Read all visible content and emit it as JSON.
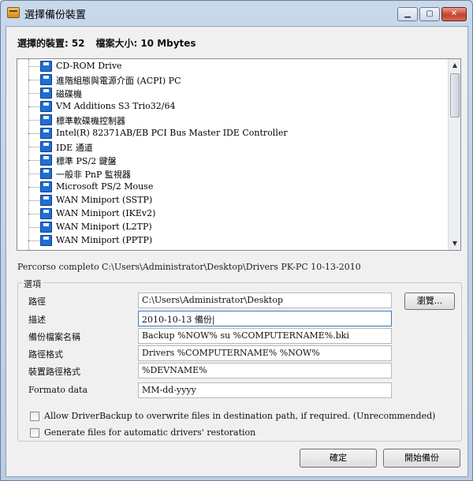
{
  "window": {
    "title": "選擇備份裝置"
  },
  "summary": {
    "devices_label": "選擇的裝置:",
    "devices_count": "52",
    "size_label": "檔案大小:",
    "size_value": "10 Mbytes"
  },
  "tree": {
    "items": [
      {
        "label": "CD-ROM Drive"
      },
      {
        "label": "進階組態與電源介面 (ACPI) PC"
      },
      {
        "label": "磁碟機"
      },
      {
        "label": "VM Additions S3 Trio32/64"
      },
      {
        "label": "標準軟碟機控制器"
      },
      {
        "label": "Intel(R) 82371AB/EB PCI Bus Master IDE Controller"
      },
      {
        "label": "IDE 通道"
      },
      {
        "label": "標準 PS/2 鍵盤"
      },
      {
        "label": "一般非 PnP 監視器"
      },
      {
        "label": "Microsoft PS/2 Mouse"
      },
      {
        "label": "WAN Miniport (SSTP)"
      },
      {
        "label": "WAN Miniport (IKEv2)"
      },
      {
        "label": "WAN Miniport (L2TP)"
      },
      {
        "label": "WAN Miniport (PPTP)"
      }
    ]
  },
  "path": {
    "label": "Percorso completo",
    "value": "C:\\Users\\Administrator\\Desktop\\Drivers PK-PC 10-13-2010"
  },
  "options": {
    "legend": "選項",
    "path_label": "路徑",
    "path_value": "C:\\Users\\Administrator\\Desktop",
    "browse_label": "瀏覽...",
    "desc_label": "描述",
    "desc_value": "2010-10-13 備份|",
    "filename_label": "備份檔案名稱",
    "filename_value": "Backup %NOW% su %COMPUTERNAME%.bki",
    "pathformat_label": "路徑格式",
    "pathformat_value": "Drivers %COMPUTERNAME% %NOW%",
    "devpathformat_label": "裝置路徑格式",
    "devpathformat_value": "%DEVNAME%",
    "dateformat_label": "Formato data",
    "dateformat_value": "MM-dd-yyyy",
    "overwrite_label": "Allow DriverBackup to overwrite files in destination path, if required. (Unrecommended)",
    "overwrite_checked": false,
    "restore_label": "Generate files for automatic drivers' restoration",
    "restore_checked": false
  },
  "buttons": {
    "ok_label": "確定",
    "start_label": "開始備份"
  },
  "colors": {
    "device_icon": "#1e6fd6",
    "title_bar": "#c9d9ec"
  },
  "icons": {
    "title": "app-icon",
    "device": "device-icon",
    "minimize": "minimize-icon",
    "maximize": "maximize-icon",
    "close": "close-icon"
  }
}
